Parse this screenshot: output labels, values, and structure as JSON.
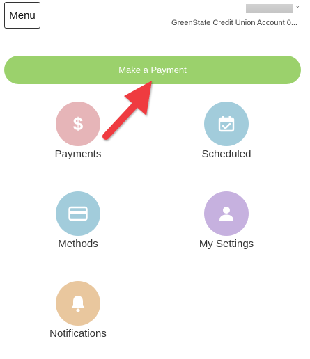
{
  "header": {
    "menu_label": "Menu",
    "account_name": "GreenState Credit Union Account 0...",
    "caret_icon": "chevron-down-icon"
  },
  "primary_action": {
    "label": "Make a Payment",
    "color": "#9bd16c"
  },
  "tiles": [
    {
      "label": "Payments",
      "icon": "dollar-icon",
      "color": "#e6b5b8"
    },
    {
      "label": "Scheduled",
      "icon": "calendar-check-icon",
      "color": "#a2ccdb"
    },
    {
      "label": "Methods",
      "icon": "credit-card-icon",
      "color": "#a2ccdb"
    },
    {
      "label": "My Settings",
      "icon": "person-icon",
      "color": "#c6b1df"
    },
    {
      "label": "Notifications",
      "icon": "bell-icon",
      "color": "#e9c79e"
    }
  ],
  "annotation": {
    "arrow_color": "#ef3b3f"
  }
}
